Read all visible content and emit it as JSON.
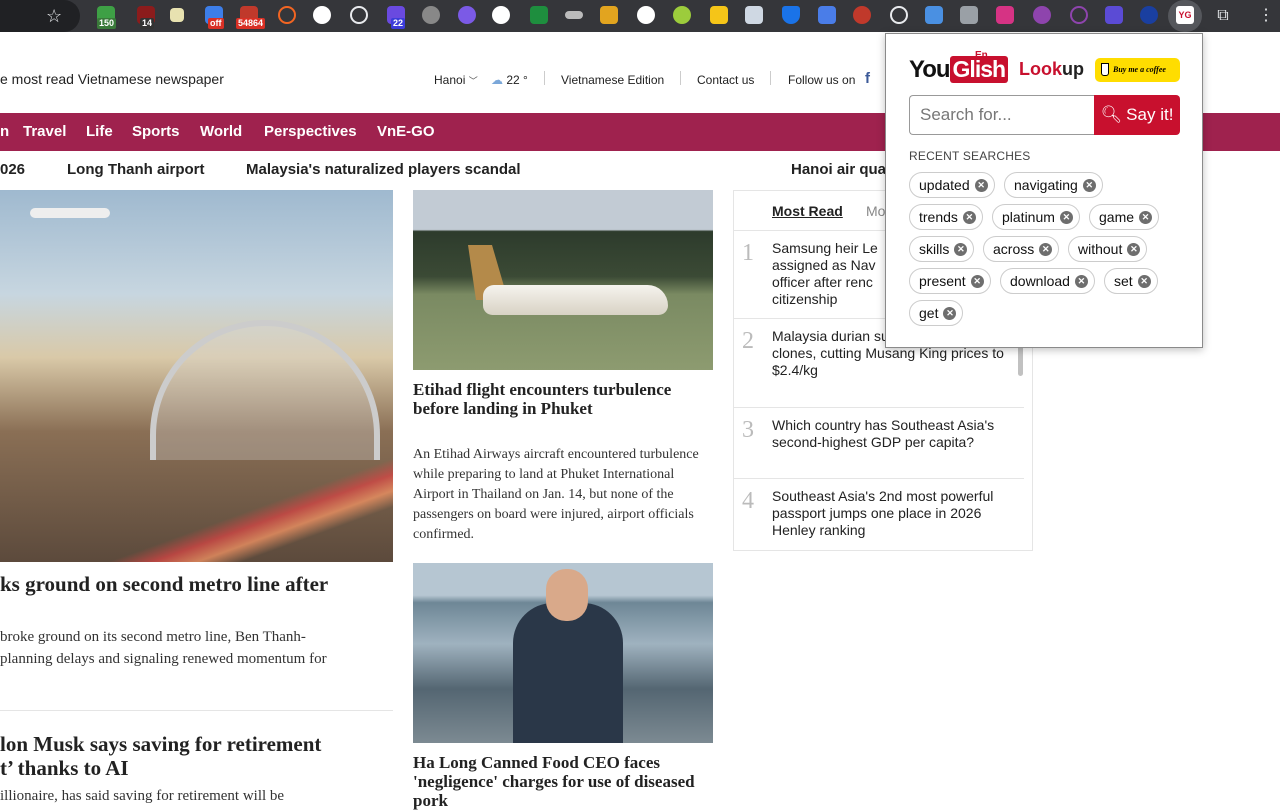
{
  "toolbar": {
    "badges": [
      "150",
      "14",
      "off",
      "54864",
      "22"
    ],
    "yg_icon_text": "YG"
  },
  "header": {
    "tagline": "e most read Vietnamese newspaper",
    "city": "Hanoi",
    "temperature": "22 °",
    "edition": "Vietnamese Edition",
    "contact": "Contact us",
    "follow": "Follow us on",
    "fb": "f"
  },
  "nav": [
    "n",
    "Travel",
    "Life",
    "Sports",
    "World",
    "Perspectives",
    "VnE-GO"
  ],
  "ticker": [
    "026",
    "Long Thanh airport",
    "Malaysia's naturalized players scandal",
    "Hanoi air qua"
  ],
  "articles": {
    "hero": {
      "title": "ks ground on second metro line after",
      "lead_1": "broke ground on its second metro line, Ben Thanh-",
      "lead_2": "planning delays and signaling renewed momentum for"
    },
    "etihad": {
      "title": "Etihad flight encounters turbulence before landing in Phuket",
      "lead": "An Etihad Airways aircraft encountered turbulence while preparing to land at Phuket International Airport in Thailand on Jan. 14, but none of the passengers on board were injured, airport officials confirmed."
    },
    "musk": {
      "title_1": "lon Musk says saving for retirement",
      "title_2": "t’ thanks to AI",
      "lead": "illionaire, has said saving for retirement will be"
    },
    "halong": {
      "title": "Ha Long Canned Food CEO faces 'negligence' charges for use of diseased pork"
    }
  },
  "most_read": {
    "tab_active": "Most Read",
    "tab_other": "Mo",
    "items": [
      {
        "num": "1",
        "title": "Samsung heir Le assigned as Nav officer after renc citizenship"
      },
      {
        "num": "2",
        "title": "Malaysia durian sub-standard export clones, cutting Musang King prices to $2.4/kg"
      },
      {
        "num": "3",
        "title": "Which country has Southeast Asia's second-highest GDP per capita?"
      },
      {
        "num": "4",
        "title": "Southeast Asia's 2nd most powerful passport jumps one place in 2026 Henley ranking"
      }
    ]
  },
  "popup": {
    "logo_you": "You",
    "logo_glish": "Glish",
    "logo_en": "En",
    "lookup_1": "Look",
    "lookup_2": "up",
    "coffee": "Buy me a coffee",
    "search_placeholder": "Search for...",
    "say_label": "Say it!",
    "recent_label": "RECENT SEARCHES",
    "chips": [
      "updated",
      "navigating",
      "trends",
      "platinum",
      "game",
      "skills",
      "across",
      "without",
      "present",
      "download",
      "set",
      "get"
    ]
  },
  "colors": {
    "nav_bg": "#9f224e",
    "youglish_red": "#c8102e",
    "coffee_yellow": "#ffdd00"
  }
}
